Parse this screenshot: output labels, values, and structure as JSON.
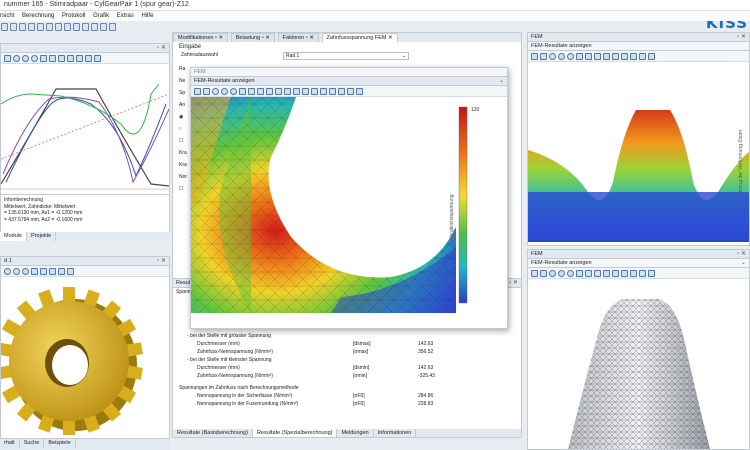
{
  "window": {
    "title": "nummer 165 - Stirnradpaar - CylGearPair 1 (spur gear)-Z12"
  },
  "logo": "KISS",
  "menu": [
    "rsicht",
    "Berechnung",
    "Protokoll",
    "Grafik",
    "Extras",
    "Hilfe"
  ],
  "left_top_panel": {
    "info_lines": [
      "Infomberechnung",
      "Mittelwert, Zahndicke: Mittelwert",
      "= 135.6130 mm, As1 = -0.1200 mm",
      "= 437.5794 mm, As2 = -0.1600 mm"
    ],
    "tabs": [
      "Module",
      "Projekte"
    ]
  },
  "left_bottom_panel": {
    "head": "d 1"
  },
  "left_footer_tabs": [
    "rhalt",
    "Suche",
    "Beispiele"
  ],
  "center_tabs": [
    "Modifikationen",
    "Belastung",
    "Faktoren",
    "Zahnfussspannung FEM"
  ],
  "center_form": {
    "heading": "Eingabe",
    "gear_label": "Zahnradauswahl",
    "gear_value": "Rad 1",
    "side_labels": [
      "Ra",
      "Ne",
      "Sp",
      "An",
      "Kra",
      "Kra",
      "Nor"
    ]
  },
  "fem_popup": {
    "window_label": "FEM",
    "title": "FEM-Resultate anzeigen",
    "scale_label": "Vergleichsspannung",
    "scale_max": "120"
  },
  "center_results": {
    "rows_left": [
      "Resul",
      "Spann"
    ],
    "sec_max": "- bei der Stelle mit grösster Spannung",
    "rows_max": [
      {
        "label": "Durchmesser (mm)",
        "sym": "[dsmax]",
        "val": "142.63"
      },
      {
        "label": "Zahnfuss-Nennspannung (N/mm²)",
        "sym": "[σmax]",
        "val": "356.52"
      }
    ],
    "sec_min": "- bei der Stelle mit kleinster Spannung",
    "rows_min": [
      {
        "label": "Durchmesser (mm)",
        "sym": "[dsmin]",
        "val": "142.63"
      },
      {
        "label": "Zahnfuss-Nennspannung (N/mm²)",
        "sym": "[σmin]",
        "val": "-325.43"
      }
    ],
    "sec_methods": "Spannungen im Zahnfuss nach Berechnungsmethode",
    "rows_methods": [
      {
        "label": "Nennspannung in der Sicherfasse (N/mm²)",
        "sym": "[σF0]",
        "val": "284.86"
      },
      {
        "label": "Nennspannung in der Fusenrundung (N/mm²)",
        "sym": "[σF0]",
        "val": "228.83"
      }
    ],
    "bottom_tabs": [
      "Resultate (Basisberechnung)",
      "Resultate (Spezialberechnung)",
      "Meldungen",
      "Informationen"
    ]
  },
  "right_top_panel": {
    "head": "FEM",
    "subhead": "FEM-Resultate anzeigen",
    "scale_label": "Bezug der Verformung Zoom"
  },
  "right_bottom_panel": {
    "head": "FEM",
    "subhead": "FEM-Resultate anzeigen"
  },
  "colors": {
    "accent": "#1d6fb8",
    "panel_header": "#e3e9f0",
    "gear_yellow": "#e4bb22",
    "stress_red": "#c8131a",
    "stress_blue": "#2d3fd0"
  }
}
